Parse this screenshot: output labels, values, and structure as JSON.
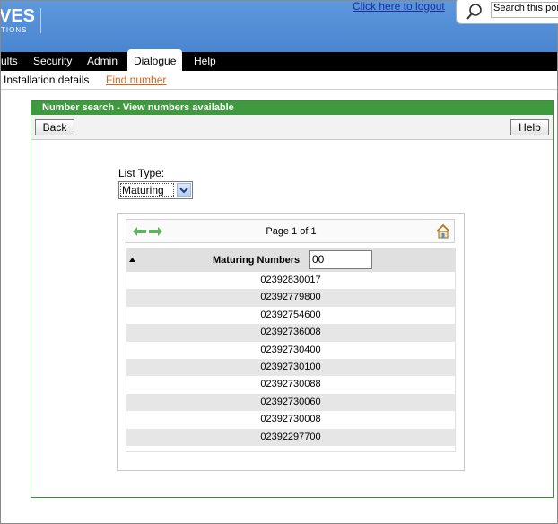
{
  "header": {
    "logo_line1": "VES",
    "logo_line2": "TIONS",
    "logout_link": "Click here to logout",
    "search_value": "Search this port"
  },
  "nav": {
    "tabs": [
      {
        "label": "ults"
      },
      {
        "label": "Security"
      },
      {
        "label": "Admin"
      },
      {
        "label": "Dialogue",
        "active": true
      },
      {
        "label": "Help"
      }
    ]
  },
  "subnav": {
    "items": [
      {
        "label": "Installation details"
      },
      {
        "label": "Find number",
        "link": true
      }
    ]
  },
  "panel": {
    "title": "Number search - View numbers available",
    "back_label": "Back",
    "help_label": "Help",
    "list_type_label": "List Type:",
    "list_type_value": "Maturing",
    "page_label": "Page 1 of 1",
    "column_title": "Maturing Numbers",
    "filter_value": "00",
    "numbers": [
      "02392830017",
      "02392779800",
      "02392754600",
      "02392736008",
      "02392730400",
      "02392730100",
      "02392730088",
      "02392730060",
      "02392730008",
      "02392297700"
    ]
  },
  "colors": {
    "banner": "#4a86d0",
    "panel_header": "#3f9a3f",
    "link_orange": "#d0651e",
    "logout_blue": "#1a2fa0"
  }
}
